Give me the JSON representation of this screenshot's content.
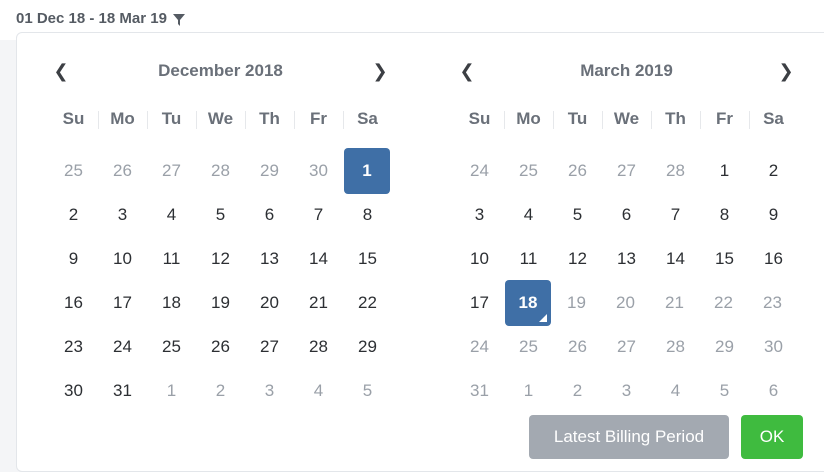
{
  "range_label": "01 Dec 18 - 18 Mar 19",
  "weekdays": [
    "Su",
    "Mo",
    "Tu",
    "We",
    "Th",
    "Fr",
    "Sa"
  ],
  "months": [
    {
      "title": "December 2018",
      "weeks": [
        [
          {
            "d": "25",
            "muted": true
          },
          {
            "d": "26",
            "muted": true
          },
          {
            "d": "27",
            "muted": true
          },
          {
            "d": "28",
            "muted": true
          },
          {
            "d": "29",
            "muted": true
          },
          {
            "d": "30",
            "muted": true
          },
          {
            "d": "1",
            "selected": true
          }
        ],
        [
          {
            "d": "2"
          },
          {
            "d": "3"
          },
          {
            "d": "4"
          },
          {
            "d": "5"
          },
          {
            "d": "6"
          },
          {
            "d": "7"
          },
          {
            "d": "8"
          }
        ],
        [
          {
            "d": "9"
          },
          {
            "d": "10"
          },
          {
            "d": "11"
          },
          {
            "d": "12"
          },
          {
            "d": "13"
          },
          {
            "d": "14"
          },
          {
            "d": "15"
          }
        ],
        [
          {
            "d": "16"
          },
          {
            "d": "17"
          },
          {
            "d": "18"
          },
          {
            "d": "19"
          },
          {
            "d": "20"
          },
          {
            "d": "21"
          },
          {
            "d": "22"
          }
        ],
        [
          {
            "d": "23"
          },
          {
            "d": "24"
          },
          {
            "d": "25"
          },
          {
            "d": "26"
          },
          {
            "d": "27"
          },
          {
            "d": "28"
          },
          {
            "d": "29"
          }
        ],
        [
          {
            "d": "30"
          },
          {
            "d": "31"
          },
          {
            "d": "1",
            "muted": true
          },
          {
            "d": "2",
            "muted": true
          },
          {
            "d": "3",
            "muted": true
          },
          {
            "d": "4",
            "muted": true
          },
          {
            "d": "5",
            "muted": true
          }
        ]
      ]
    },
    {
      "title": "March 2019",
      "weeks": [
        [
          {
            "d": "24",
            "muted": true
          },
          {
            "d": "25",
            "muted": true
          },
          {
            "d": "26",
            "muted": true
          },
          {
            "d": "27",
            "muted": true
          },
          {
            "d": "28",
            "muted": true
          },
          {
            "d": "1"
          },
          {
            "d": "2"
          }
        ],
        [
          {
            "d": "3"
          },
          {
            "d": "4"
          },
          {
            "d": "5"
          },
          {
            "d": "6"
          },
          {
            "d": "7"
          },
          {
            "d": "8"
          },
          {
            "d": "9"
          }
        ],
        [
          {
            "d": "10"
          },
          {
            "d": "11"
          },
          {
            "d": "12"
          },
          {
            "d": "13"
          },
          {
            "d": "14"
          },
          {
            "d": "15"
          },
          {
            "d": "16"
          }
        ],
        [
          {
            "d": "17"
          },
          {
            "d": "18",
            "selected": true,
            "end": true
          },
          {
            "d": "19",
            "muted": true
          },
          {
            "d": "20",
            "muted": true
          },
          {
            "d": "21",
            "muted": true
          },
          {
            "d": "22",
            "muted": true
          },
          {
            "d": "23",
            "muted": true
          }
        ],
        [
          {
            "d": "24",
            "muted": true
          },
          {
            "d": "25",
            "muted": true
          },
          {
            "d": "26",
            "muted": true
          },
          {
            "d": "27",
            "muted": true
          },
          {
            "d": "28",
            "muted": true
          },
          {
            "d": "29",
            "muted": true
          },
          {
            "d": "30",
            "muted": true
          }
        ],
        [
          {
            "d": "31",
            "muted": true
          },
          {
            "d": "1",
            "muted": true
          },
          {
            "d": "2",
            "muted": true
          },
          {
            "d": "3",
            "muted": true
          },
          {
            "d": "4",
            "muted": true
          },
          {
            "d": "5",
            "muted": true
          },
          {
            "d": "6",
            "muted": true
          }
        ]
      ]
    }
  ],
  "buttons": {
    "latest": "Latest Billing Period",
    "ok": "OK"
  },
  "icons": {
    "filter": "filter-icon",
    "prev": "chevron-left-icon",
    "next": "chevron-right-icon"
  },
  "colors": {
    "selected": "#3f6fa6",
    "ok": "#3fbb3f",
    "latest": "#a3a9b1"
  }
}
